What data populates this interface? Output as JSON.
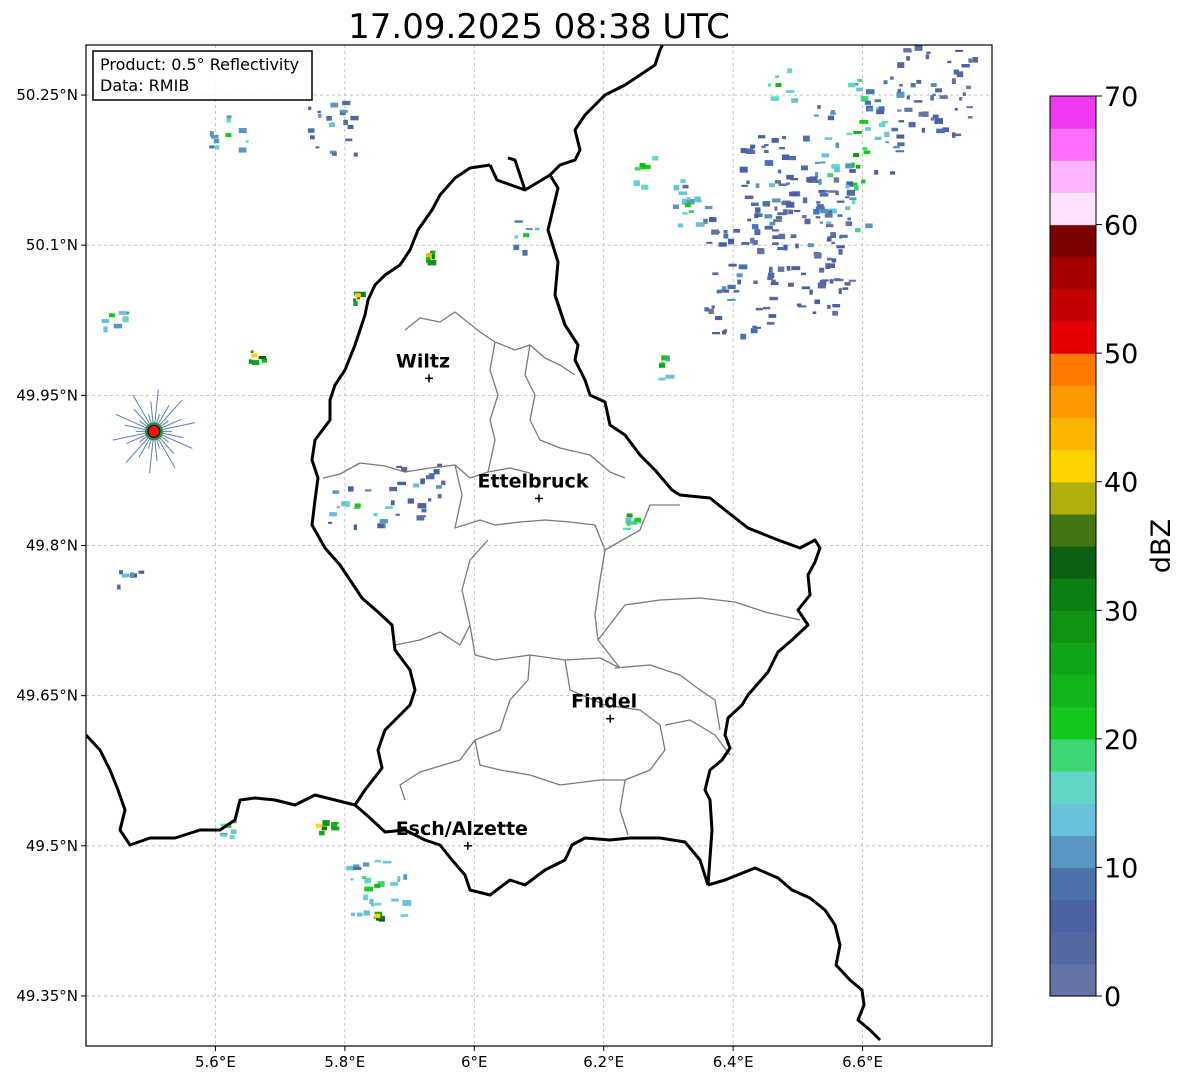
{
  "title": "17.09.2025 08:38 UTC",
  "info_box": {
    "product": "Product: 0.5° Reflectivity",
    "source": "Data: RMIB"
  },
  "axes": {
    "lon_range": [
      5.4,
      6.8
    ],
    "lat_range": [
      49.3,
      50.3
    ],
    "x_ticks": [
      {
        "value": 5.6,
        "label": "5.6°E"
      },
      {
        "value": 5.8,
        "label": "5.8°E"
      },
      {
        "value": 6.0,
        "label": "6°E"
      },
      {
        "value": 6.2,
        "label": "6.2°E"
      },
      {
        "value": 6.4,
        "label": "6.4°E"
      },
      {
        "value": 6.6,
        "label": "6.6°E"
      }
    ],
    "y_ticks": [
      {
        "value": 50.25,
        "label": "50.25°N"
      },
      {
        "value": 50.1,
        "label": "50.1°N"
      },
      {
        "value": 49.95,
        "label": "49.95°N"
      },
      {
        "value": 49.8,
        "label": "49.8°N"
      },
      {
        "value": 49.65,
        "label": "49.65°N"
      },
      {
        "value": 49.5,
        "label": "49.5°N"
      },
      {
        "value": 49.35,
        "label": "49.35°N"
      }
    ],
    "grid": true
  },
  "cities": [
    {
      "name": "Wiltz",
      "lon": 5.93,
      "lat": 49.967
    },
    {
      "name": "Ettelbruck",
      "lon": 6.1,
      "lat": 49.847
    },
    {
      "name": "Findel",
      "lon": 6.21,
      "lat": 49.627
    },
    {
      "name": "Esch/Alzette",
      "lon": 5.99,
      "lat": 49.5
    }
  ],
  "radar_site": {
    "lon": 5.505,
    "lat": 49.914,
    "color": "#e8160c"
  },
  "colorbar": {
    "label": "dBZ",
    "min": 0,
    "max": 70,
    "step": 2.5,
    "ticks": [
      {
        "value": 0,
        "label": "0"
      },
      {
        "value": 10,
        "label": "10"
      },
      {
        "value": 20,
        "label": "20"
      },
      {
        "value": 30,
        "label": "30"
      },
      {
        "value": 40,
        "label": "40"
      },
      {
        "value": 50,
        "label": "50"
      },
      {
        "value": 60,
        "label": "60"
      },
      {
        "value": 70,
        "label": "70"
      }
    ],
    "colors": [
      "#6573a5",
      "#55689f",
      "#4a61a3",
      "#4c72ae",
      "#5a96c4",
      "#68c2dc",
      "#62d7c5",
      "#3fd574",
      "#14c81e",
      "#12b61c",
      "#11a519",
      "#0f9414",
      "#0d7e12",
      "#0b6110",
      "#447513",
      "#afb00b",
      "#fed300",
      "#feb500",
      "#fe9900",
      "#fe7b00",
      "#e40000",
      "#c50000",
      "#a40000",
      "#7d0000",
      "#ffe3fc",
      "#ffb5fd",
      "#fe6ef8",
      "#ee39f1"
    ]
  },
  "reflectivity_echoes": {
    "units": "dBZ",
    "cells": [
      {
        "lon": 6.59,
        "lat": 50.19,
        "dbz": 28,
        "w": 0.015,
        "h": 0.08
      },
      {
        "lon": 6.55,
        "lat": 50.17,
        "dbz": 18,
        "w": 0.03,
        "h": 0.07
      },
      {
        "lon": 6.63,
        "lat": 50.22,
        "dbz": 16,
        "w": 0.03,
        "h": 0.05
      },
      {
        "lon": 6.46,
        "lat": 50.16,
        "dbz": 14,
        "w": 0.05,
        "h": 0.05
      },
      {
        "lon": 6.41,
        "lat": 50.07,
        "dbz": 12,
        "w": 0.06,
        "h": 0.06
      },
      {
        "lon": 6.52,
        "lat": 50.1,
        "dbz": 10,
        "w": 0.06,
        "h": 0.07
      },
      {
        "lon": 6.33,
        "lat": 50.14,
        "dbz": 20,
        "w": 0.03,
        "h": 0.03
      },
      {
        "lon": 6.26,
        "lat": 50.18,
        "dbz": 24,
        "w": 0.02,
        "h": 0.02
      },
      {
        "lon": 6.71,
        "lat": 50.26,
        "dbz": 10,
        "w": 0.06,
        "h": 0.05
      },
      {
        "lon": 6.47,
        "lat": 50.26,
        "dbz": 24,
        "w": 0.02,
        "h": 0.02
      },
      {
        "lon": 5.78,
        "lat": 50.22,
        "dbz": 14,
        "w": 0.04,
        "h": 0.03
      },
      {
        "lon": 5.62,
        "lat": 50.21,
        "dbz": 22,
        "w": 0.03,
        "h": 0.02
      },
      {
        "lon": 5.93,
        "lat": 50.09,
        "dbz": 44,
        "w": 0.005,
        "h": 0.005
      },
      {
        "lon": 5.82,
        "lat": 50.05,
        "dbz": 42,
        "w": 0.008,
        "h": 0.006
      },
      {
        "lon": 5.66,
        "lat": 49.99,
        "dbz": 40,
        "w": 0.012,
        "h": 0.008
      },
      {
        "lon": 5.44,
        "lat": 50.03,
        "dbz": 22,
        "w": 0.03,
        "h": 0.015
      },
      {
        "lon": 5.82,
        "lat": 49.84,
        "dbz": 20,
        "w": 0.05,
        "h": 0.02
      },
      {
        "lon": 5.91,
        "lat": 49.86,
        "dbz": 14,
        "w": 0.04,
        "h": 0.03
      },
      {
        "lon": 5.46,
        "lat": 49.77,
        "dbz": 14,
        "w": 0.04,
        "h": 0.01
      },
      {
        "lon": 5.62,
        "lat": 49.52,
        "dbz": 22,
        "w": 0.03,
        "h": 0.01
      },
      {
        "lon": 5.76,
        "lat": 49.52,
        "dbz": 40,
        "w": 0.02,
        "h": 0.006
      },
      {
        "lon": 5.85,
        "lat": 49.46,
        "dbz": 24,
        "w": 0.05,
        "h": 0.03
      },
      {
        "lon": 5.85,
        "lat": 49.43,
        "dbz": 42,
        "w": 0.01,
        "h": 0.005
      },
      {
        "lon": 6.24,
        "lat": 49.83,
        "dbz": 26,
        "w": 0.012,
        "h": 0.02
      },
      {
        "lon": 6.29,
        "lat": 49.98,
        "dbz": 26,
        "w": 0.008,
        "h": 0.015
      },
      {
        "lon": 6.08,
        "lat": 50.11,
        "dbz": 22,
        "w": 0.02,
        "h": 0.015
      }
    ]
  }
}
